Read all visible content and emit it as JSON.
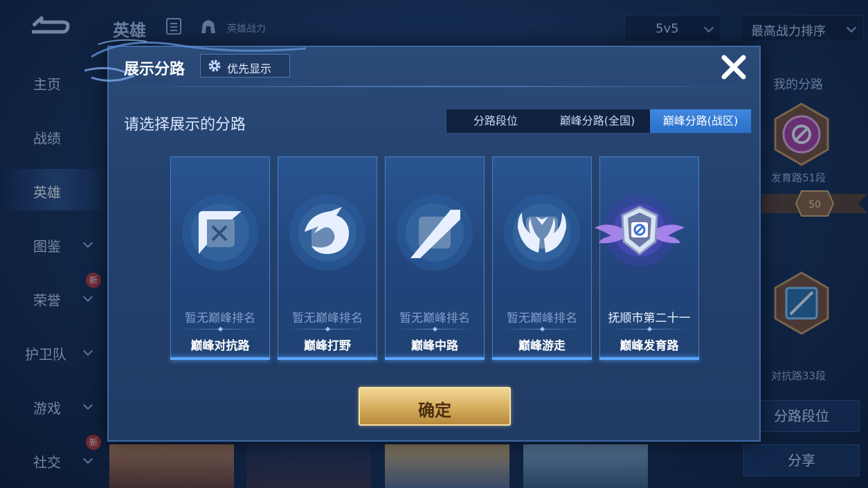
{
  "background": {
    "title": "英雄",
    "subtitle": "英雄战力",
    "mode_select": "5v5",
    "sort_select": "最高战力排序",
    "sidebar": [
      {
        "label": "主页"
      },
      {
        "label": "战绩"
      },
      {
        "label": "英雄"
      },
      {
        "label": "图鉴"
      },
      {
        "label": "荣誉",
        "badge": "新"
      },
      {
        "label": "护卫队"
      },
      {
        "label": "游戏"
      },
      {
        "label": "社交",
        "badge": "新"
      }
    ],
    "right_panel": {
      "title": "我的分路",
      "rank1": "发育路51段",
      "ribbon_number": "50",
      "rank2": "对抗路33段",
      "lane_rank_button": "分路段位",
      "share_button": "分享"
    }
  },
  "modal": {
    "title": "展示分路",
    "priority_button": "优先显示",
    "prompt": "请选择展示的分路",
    "tabs": [
      {
        "label": "分路段位",
        "active": false
      },
      {
        "label": "巅峰分路(全国)",
        "active": false
      },
      {
        "label": "巅峰分路(战区)",
        "active": true
      }
    ],
    "lanes": [
      {
        "rank": "暂无巅峰排名",
        "name": "巅峰对抗路",
        "icon": "sword-shield-icon"
      },
      {
        "rank": "暂无巅峰排名",
        "name": "巅峰打野",
        "icon": "dragon-icon"
      },
      {
        "rank": "暂无巅峰排名",
        "name": "巅峰中路",
        "icon": "staff-icon"
      },
      {
        "rank": "暂无巅峰排名",
        "name": "巅峰游走",
        "icon": "wings-icon"
      },
      {
        "rank": "抚顺市第二十一",
        "name": "巅峰发育路",
        "icon": "winged-badge-icon"
      }
    ],
    "confirm_button": "确定"
  },
  "colors": {
    "modal_bg": "#24416d",
    "tab_active": "#3f88e0",
    "confirm_gold": "#d4ac5c"
  }
}
